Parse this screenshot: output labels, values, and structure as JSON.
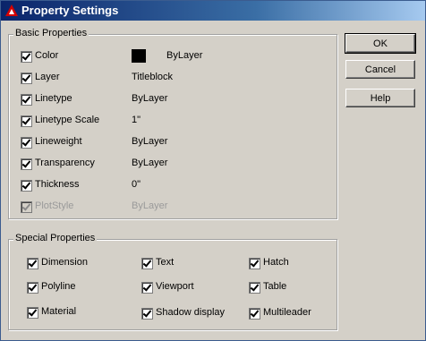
{
  "window": {
    "title": "Property Settings"
  },
  "basic": {
    "legend": "Basic Properties",
    "rows": [
      {
        "label": "Color",
        "value": "ByLayer",
        "checked": true,
        "enabled": true,
        "swatch": "#000000"
      },
      {
        "label": "Layer",
        "value": "Titleblock",
        "checked": true,
        "enabled": true
      },
      {
        "label": "Linetype",
        "value": "ByLayer",
        "checked": true,
        "enabled": true
      },
      {
        "label": "Linetype Scale",
        "value": "1\"",
        "checked": true,
        "enabled": true
      },
      {
        "label": "Lineweight",
        "value": "ByLayer",
        "checked": true,
        "enabled": true
      },
      {
        "label": "Transparency",
        "value": "ByLayer",
        "checked": true,
        "enabled": true
      },
      {
        "label": "Thickness",
        "value": "0\"",
        "checked": true,
        "enabled": true
      },
      {
        "label": "PlotStyle",
        "value": "ByLayer",
        "checked": true,
        "enabled": false
      }
    ]
  },
  "special": {
    "legend": "Special Properties",
    "items": [
      {
        "label": "Dimension",
        "checked": true
      },
      {
        "label": "Text",
        "checked": true
      },
      {
        "label": "Hatch",
        "checked": true
      },
      {
        "label": "Polyline",
        "checked": true
      },
      {
        "label": "Viewport",
        "checked": true
      },
      {
        "label": "Table",
        "checked": true
      },
      {
        "label": "Material",
        "checked": true
      },
      {
        "label": "Shadow display",
        "checked": true
      },
      {
        "label": "Multileader",
        "checked": true
      }
    ]
  },
  "buttons": {
    "ok": "OK",
    "cancel": "Cancel",
    "help": "Help"
  }
}
